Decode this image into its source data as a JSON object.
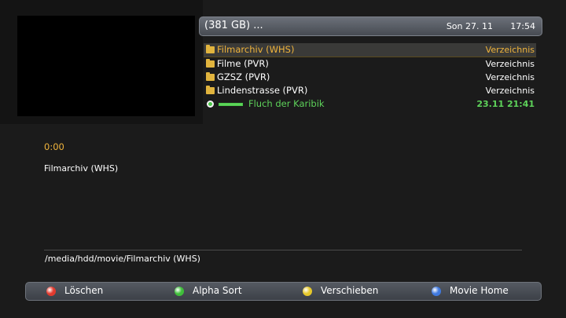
{
  "header": {
    "title": "(381 GB) ...",
    "date": "Son 27. 11",
    "time": "17:54"
  },
  "list": [
    {
      "label": "Filmarchiv (WHS)",
      "value": "Verzeichnis",
      "icon": "folder-icon",
      "selected": true
    },
    {
      "label": "Filme (PVR)",
      "value": "Verzeichnis",
      "icon": "folder-icon",
      "selected": false
    },
    {
      "label": "GZSZ (PVR)",
      "value": "Verzeichnis",
      "icon": "folder-icon",
      "selected": false
    },
    {
      "label": "Lindenstrasse (PVR)",
      "value": "Verzeichnis",
      "icon": "folder-icon",
      "selected": false
    }
  ],
  "recording": {
    "label": "Fluch der Karibik",
    "value": "23.11 21:41",
    "icon": "recording-icon",
    "progress": 1.0
  },
  "info": {
    "elapsed": "0:00",
    "name": "Filmarchiv (WHS)",
    "path": "/media/hdd/movie/Filmarchiv (WHS)"
  },
  "buttons": [
    {
      "label": "Löschen",
      "color": "#e23a2e",
      "icon": "red-key-icon"
    },
    {
      "label": "Alpha Sort",
      "color": "#3fbf3a",
      "icon": "green-key-icon"
    },
    {
      "label": "Verschieben",
      "color": "#e6c82a",
      "icon": "yellow-key-icon"
    },
    {
      "label": "Movie Home",
      "color": "#3f79e0",
      "icon": "blue-key-icon"
    }
  ],
  "colors": {
    "highlight": "#f0b43c",
    "recording": "#5ed35a",
    "background": "#1b1b1b"
  }
}
